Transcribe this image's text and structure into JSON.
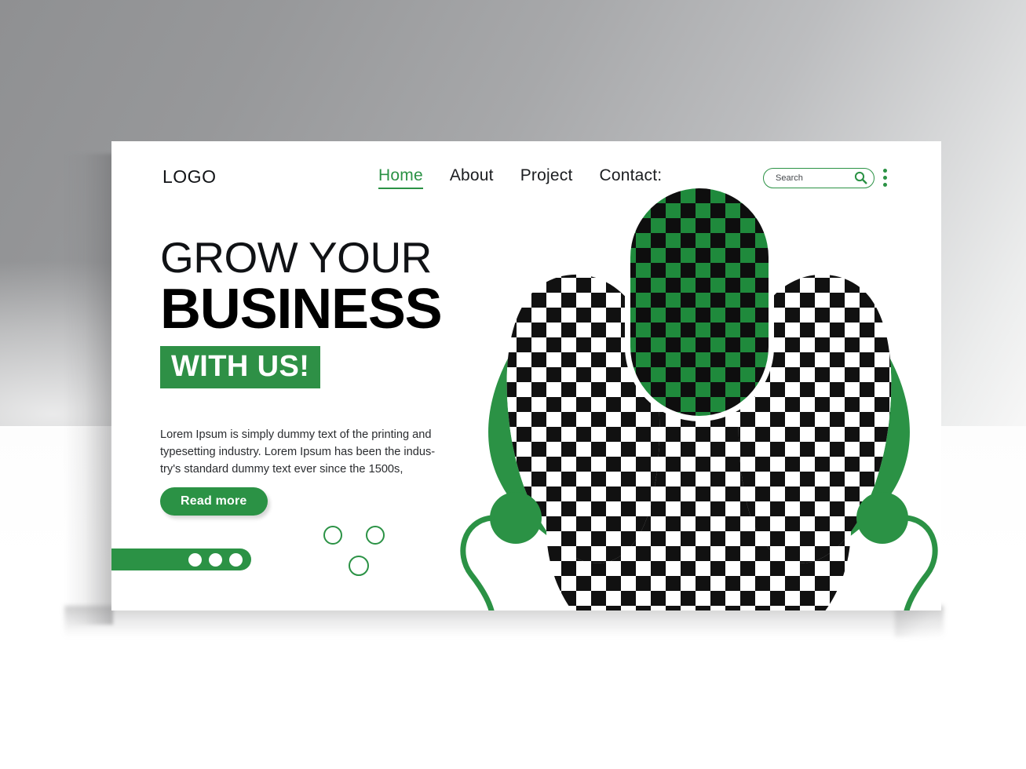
{
  "header": {
    "logo": "LOGO",
    "nav": [
      {
        "label": "Home",
        "active": true
      },
      {
        "label": "About",
        "active": false
      },
      {
        "label": "Project",
        "active": false
      },
      {
        "label": "Contact:",
        "active": false
      }
    ],
    "search": {
      "value": "",
      "placeholder": "Search",
      "icon": "search-icon"
    },
    "menu_icon": "kebab-menu-icon"
  },
  "hero": {
    "headline_line1": "GROW YOUR",
    "headline_line2": "BUSINESS",
    "headline_badge": "WITH US!",
    "paragraph": "Lorem Ipsum is simply dummy text of the printing and typesetting industry. Lorem Ipsum has been the indus-try's standard dummy text ever since the 1500s,",
    "cta_label": "Read more",
    "carousel": {
      "dots": 3,
      "active_index": 0
    },
    "decor": {
      "rings": 3
    },
    "illustration": {
      "alt": "checkerboard placeholder artwork",
      "shapes": [
        "center-capsule-green-checker",
        "left-petal-checker",
        "right-petal-checker",
        "green-swoosh-left",
        "green-swoosh-right",
        "green-circle-left",
        "green-circle-right",
        "green-curve-left",
        "green-curve-right"
      ]
    }
  },
  "colors": {
    "brand_green": "#2b9245",
    "badge_green": "#2e9046",
    "checker_green": "#1f8a3c",
    "checker_dark": "#101010",
    "text_dark": "#101215",
    "body_text": "#2a2c2f",
    "card_bg": "#ffffff"
  }
}
